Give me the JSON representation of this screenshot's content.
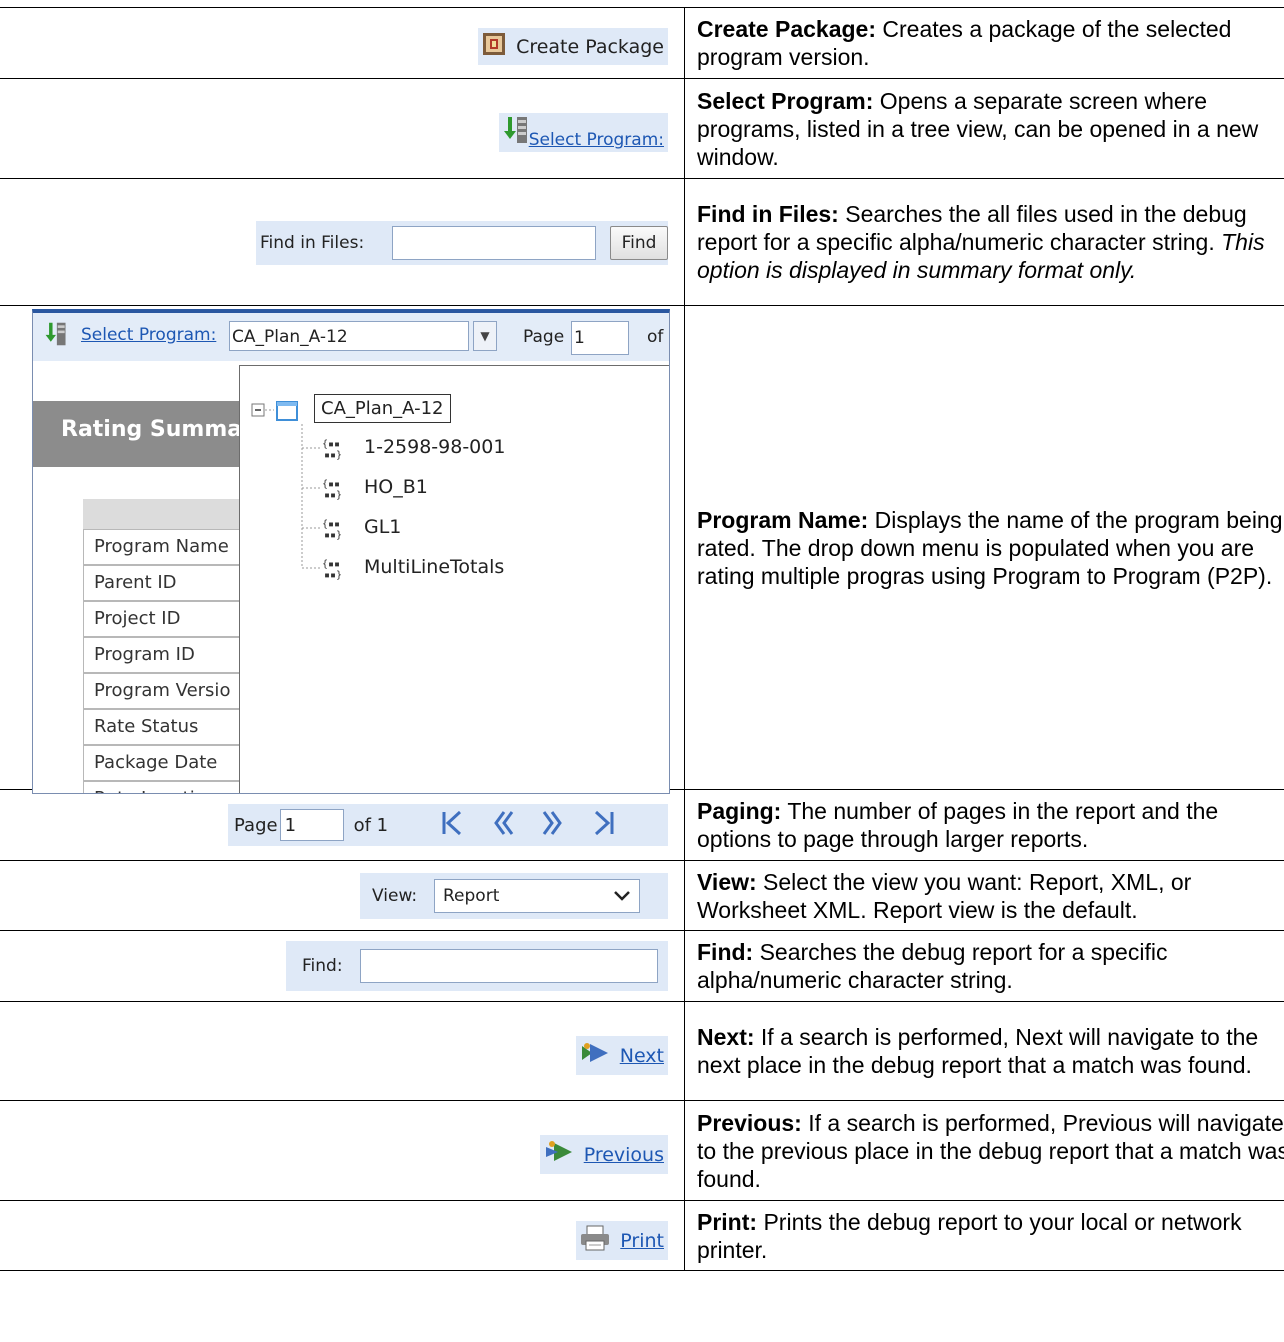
{
  "rows": [
    {
      "ui": {
        "label": "Create Package"
      },
      "desc": {
        "term": "Create Package:",
        "text": " Creates a package of the selected program version."
      }
    },
    {
      "ui": {
        "label": "Select Program:"
      },
      "desc": {
        "term": "Select Program:",
        "text": " Opens a separate screen where programs, listed in a tree view, can be opened in a new window."
      }
    },
    {
      "ui": {
        "label": "Find in Files:",
        "button": "Find",
        "value": ""
      },
      "desc": {
        "term": "Find in Files:",
        "text": "  Searches the all files used in the debug report for a specific alpha/numeric character string. ",
        "note": "This option is displayed in summary format only."
      }
    },
    {
      "ui": {
        "select_label": "Select Program:",
        "selected": "CA_Plan_A-12",
        "page_label": "Page",
        "page_value": "1",
        "of_label": "of",
        "summary_title": "Rating Summar",
        "rows": [
          "Program Name",
          "Parent ID",
          "Project ID",
          "Program ID",
          "Program Versio",
          "Rate Status",
          "Package Date",
          "Rate Location"
        ],
        "tree": {
          "root": "CA_Plan_A-12",
          "children": [
            "1-2598-98-001",
            "HO_B1",
            "GL1",
            "MultiLineTotals"
          ]
        }
      },
      "desc": {
        "term": "Program Name:",
        "text": " Displays the name of the program being rated. The drop down menu is populated when you are rating multiple progras using Program to Program (P2P)."
      }
    },
    {
      "ui": {
        "page_label": "Page",
        "page_value": "1",
        "of_label": "of 1"
      },
      "desc": {
        "term": "Paging:",
        "text": " The number of pages in the report and the options to page through larger reports."
      }
    },
    {
      "ui": {
        "label": "View:",
        "selected": "Report"
      },
      "desc": {
        "term": "View:",
        "text": " Select the view you want: Report, XML, or Worksheet XML. Report view is the default."
      }
    },
    {
      "ui": {
        "label": "Find:",
        "value": ""
      },
      "desc": {
        "term": "Find:",
        "text": " Searches the debug report for a specific alpha/numeric character string."
      }
    },
    {
      "ui": {
        "label": "Next"
      },
      "desc": {
        "term": "Next:",
        "text": " If a search is performed, Next will navigate to the next place in the debug report that a match was found."
      }
    },
    {
      "ui": {
        "label": "Previous"
      },
      "desc": {
        "term": "Previous:",
        "text": " If a search is performed, Previous will navigate to the previous place in the debug report that a match was found."
      }
    },
    {
      "ui": {
        "label": "Print"
      },
      "desc": {
        "term": "Print:",
        "text": " Prints the debug report to your local or network printer."
      }
    }
  ],
  "icons": {
    "package": "package-icon",
    "select": "select-program-icon",
    "first": "first-page-icon",
    "prev": "prev-page-icon",
    "nextp": "next-page-icon",
    "last": "last-page-icon",
    "next": "next-icon",
    "previous": "previous-icon",
    "print": "printer-icon",
    "dropdown": "chevron-down-icon"
  }
}
